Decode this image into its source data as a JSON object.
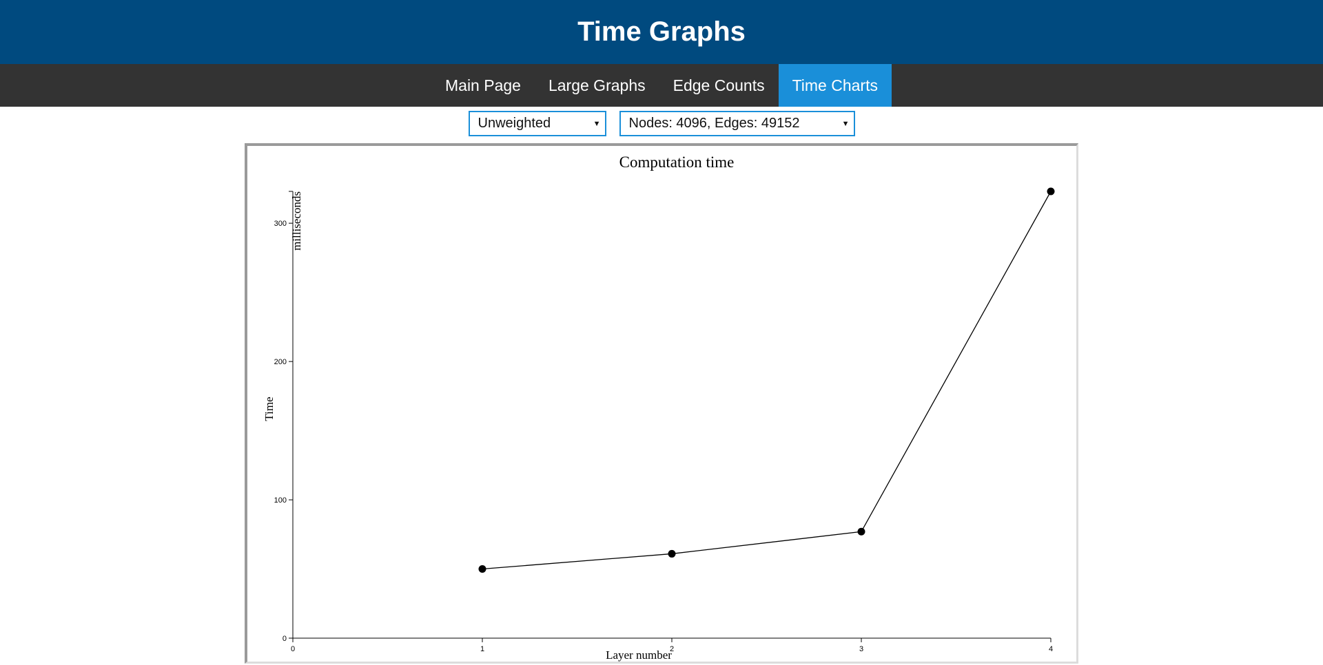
{
  "header": {
    "title": "Time Graphs"
  },
  "nav": {
    "items": [
      {
        "label": "Main Page",
        "active": false
      },
      {
        "label": "Large Graphs",
        "active": false
      },
      {
        "label": "Edge Counts",
        "active": false
      },
      {
        "label": "Time Charts",
        "active": true
      }
    ]
  },
  "controls": {
    "weight_select": {
      "value": "Unweighted"
    },
    "graph_select": {
      "value": "Nodes: 4096, Edges: 49152"
    }
  },
  "chart_data": {
    "type": "line",
    "title": "Computation time",
    "xlabel": "Layer number",
    "ylabel": "Time",
    "yunit": "milliseconds",
    "x": [
      1,
      2,
      3,
      4
    ],
    "y": [
      50,
      61,
      77,
      323
    ],
    "xlim": [
      0,
      4
    ],
    "ylim": [
      0,
      323
    ],
    "xticks": [
      0,
      1,
      2,
      3,
      4
    ],
    "yticks": [
      0,
      100,
      200,
      300
    ],
    "grid": false,
    "colors": {
      "line": "#000000",
      "point": "#000000"
    }
  }
}
